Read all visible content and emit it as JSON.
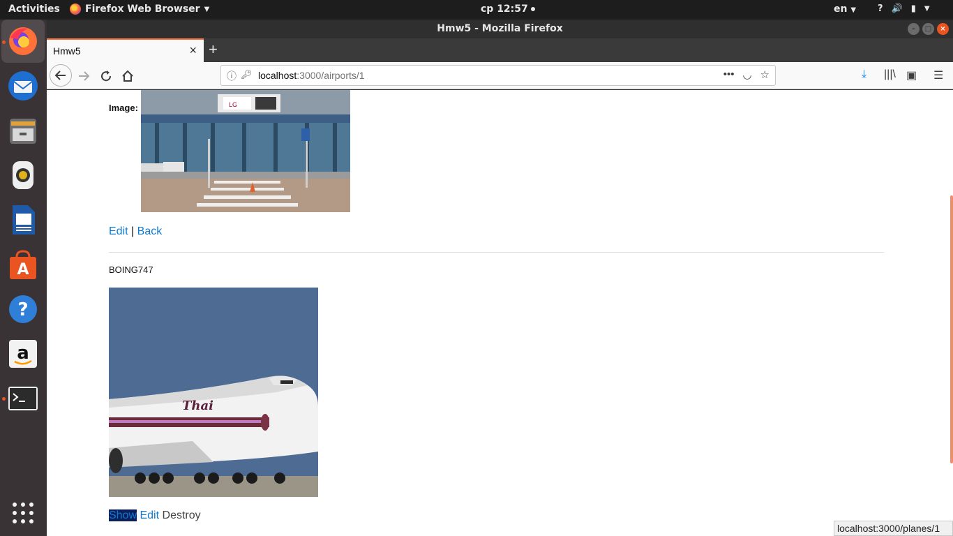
{
  "system": {
    "activities": "Activities",
    "app_menu": "Firefox Web Browser",
    "clock": "ср 12:57",
    "language": "en"
  },
  "window": {
    "title": "Hmw5 - Mozilla Firefox"
  },
  "tab": {
    "title": "Hmw5"
  },
  "urlbar": {
    "host": "localhost",
    "path": ":3000/airports/1"
  },
  "airport": {
    "image_label": "Image:",
    "links": {
      "edit": "Edit",
      "separator": "|",
      "back": "Back"
    }
  },
  "plane": {
    "name": "BOING747",
    "links": {
      "show": "Show",
      "edit": "Edit",
      "destroy": "Destroy"
    }
  },
  "status": {
    "link_preview": "localhost:3000/planes/1"
  },
  "dock": {
    "items": [
      "firefox-icon",
      "thunderbird-icon",
      "files-icon",
      "rhythmbox-icon",
      "writer-icon",
      "software-icon",
      "help-icon",
      "amazon-icon",
      "terminal-icon",
      "apps-grid-icon"
    ]
  },
  "colors": {
    "accent": "#e95420",
    "link": "#0f7bd4"
  }
}
